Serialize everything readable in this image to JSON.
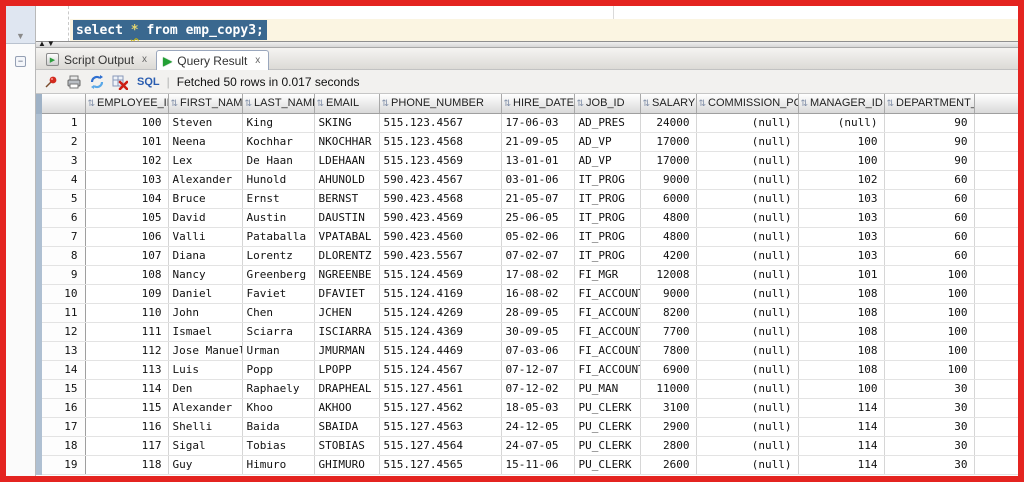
{
  "editor": {
    "sql": "select * from emp_copy3;",
    "sql_select": "select ",
    "sql_star": "*",
    "sql_rest": " from emp_copy3;"
  },
  "tabs": [
    {
      "label": "Script Output",
      "close": "x",
      "active": false
    },
    {
      "label": "Query Result",
      "close": "x",
      "active": true
    }
  ],
  "toolbar": {
    "sql_label": "SQL",
    "separator": "|",
    "status": "Fetched 50 rows in 0.017 seconds"
  },
  "grid": {
    "columns": [
      "EMPLOYEE_ID",
      "FIRST_NAME",
      "LAST_NAME",
      "EMAIL",
      "PHONE_NUMBER",
      "HIRE_DATE",
      "JOB_ID",
      "SALARY",
      "COMMISSION_PCT",
      "MANAGER_ID",
      "DEPARTMENT_ID"
    ],
    "rows": [
      [
        "100",
        "Steven",
        "King",
        "SKING",
        "515.123.4567",
        "17-06-03",
        "AD_PRES",
        "24000",
        "(null)",
        "(null)",
        "90"
      ],
      [
        "101",
        "Neena",
        "Kochhar",
        "NKOCHHAR",
        "515.123.4568",
        "21-09-05",
        "AD_VP",
        "17000",
        "(null)",
        "100",
        "90"
      ],
      [
        "102",
        "Lex",
        "De Haan",
        "LDEHAAN",
        "515.123.4569",
        "13-01-01",
        "AD_VP",
        "17000",
        "(null)",
        "100",
        "90"
      ],
      [
        "103",
        "Alexander",
        "Hunold",
        "AHUNOLD",
        "590.423.4567",
        "03-01-06",
        "IT_PROG",
        "9000",
        "(null)",
        "102",
        "60"
      ],
      [
        "104",
        "Bruce",
        "Ernst",
        "BERNST",
        "590.423.4568",
        "21-05-07",
        "IT_PROG",
        "6000",
        "(null)",
        "103",
        "60"
      ],
      [
        "105",
        "David",
        "Austin",
        "DAUSTIN",
        "590.423.4569",
        "25-06-05",
        "IT_PROG",
        "4800",
        "(null)",
        "103",
        "60"
      ],
      [
        "106",
        "Valli",
        "Pataballa",
        "VPATABAL",
        "590.423.4560",
        "05-02-06",
        "IT_PROG",
        "4800",
        "(null)",
        "103",
        "60"
      ],
      [
        "107",
        "Diana",
        "Lorentz",
        "DLORENTZ",
        "590.423.5567",
        "07-02-07",
        "IT_PROG",
        "4200",
        "(null)",
        "103",
        "60"
      ],
      [
        "108",
        "Nancy",
        "Greenberg",
        "NGREENBE",
        "515.124.4569",
        "17-08-02",
        "FI_MGR",
        "12008",
        "(null)",
        "101",
        "100"
      ],
      [
        "109",
        "Daniel",
        "Faviet",
        "DFAVIET",
        "515.124.4169",
        "16-08-02",
        "FI_ACCOUNT",
        "9000",
        "(null)",
        "108",
        "100"
      ],
      [
        "110",
        "John",
        "Chen",
        "JCHEN",
        "515.124.4269",
        "28-09-05",
        "FI_ACCOUNT",
        "8200",
        "(null)",
        "108",
        "100"
      ],
      [
        "111",
        "Ismael",
        "Sciarra",
        "ISCIARRA",
        "515.124.4369",
        "30-09-05",
        "FI_ACCOUNT",
        "7700",
        "(null)",
        "108",
        "100"
      ],
      [
        "112",
        "Jose Manuel",
        "Urman",
        "JMURMAN",
        "515.124.4469",
        "07-03-06",
        "FI_ACCOUNT",
        "7800",
        "(null)",
        "108",
        "100"
      ],
      [
        "113",
        "Luis",
        "Popp",
        "LPOPP",
        "515.124.4567",
        "07-12-07",
        "FI_ACCOUNT",
        "6900",
        "(null)",
        "108",
        "100"
      ],
      [
        "114",
        "Den",
        "Raphaely",
        "DRAPHEAL",
        "515.127.4561",
        "07-12-02",
        "PU_MAN",
        "11000",
        "(null)",
        "100",
        "30"
      ],
      [
        "115",
        "Alexander",
        "Khoo",
        "AKHOO",
        "515.127.4562",
        "18-05-03",
        "PU_CLERK",
        "3100",
        "(null)",
        "114",
        "30"
      ],
      [
        "116",
        "Shelli",
        "Baida",
        "SBAIDA",
        "515.127.4563",
        "24-12-05",
        "PU_CLERK",
        "2900",
        "(null)",
        "114",
        "30"
      ],
      [
        "117",
        "Sigal",
        "Tobias",
        "STOBIAS",
        "515.127.4564",
        "24-07-05",
        "PU_CLERK",
        "2800",
        "(null)",
        "114",
        "30"
      ],
      [
        "118",
        "Guy",
        "Himuro",
        "GHIMURO",
        "515.127.4565",
        "15-11-06",
        "PU_CLERK",
        "2600",
        "(null)",
        "114",
        "30"
      ]
    ]
  },
  "colors": {
    "frame_red": "#e42420",
    "selection_blue": "#3a688f",
    "current_line_cream": "#fbf5e2",
    "sql_link_blue": "#2a5db0",
    "play_green": "#23a035"
  }
}
